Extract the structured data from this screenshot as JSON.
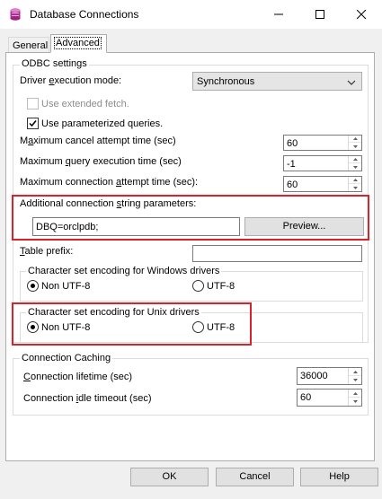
{
  "window": {
    "title": "Database Connections",
    "icon": "database-icon",
    "controls": [
      "minimize-icon",
      "maximize-icon",
      "close-icon"
    ]
  },
  "tabs": [
    {
      "label": "General",
      "active": false
    },
    {
      "label": "Advanced",
      "active": true
    }
  ],
  "odbc": {
    "group_label": "ODBC settings",
    "driver_mode_label_pre": "Driver ",
    "driver_mode_label_u": "e",
    "driver_mode_label_post": "xecution mode:",
    "driver_mode_value": "Synchronous",
    "extended_fetch_label": "Use extended fetch.",
    "extended_fetch_checked": false,
    "parameterized_label": "Use parameterized queries.",
    "parameterized_checked": true,
    "cancel_label_pre": "M",
    "cancel_label_u": "a",
    "cancel_label_post": "ximum cancel attempt time (sec)",
    "cancel_value": "60",
    "query_label_pre": "Maximum ",
    "query_label_u": "q",
    "query_label_post": "uery execution time (sec)",
    "query_value": "-1",
    "conn_attempt_label_pre": "Maximum connection ",
    "conn_attempt_label_u": "a",
    "conn_attempt_label_post": "ttempt time (sec):",
    "conn_attempt_value": "60",
    "additional_label_pre": "Additional connection ",
    "additional_label_u": "s",
    "additional_label_post": "tring parameters:",
    "additional_value": "DBQ=orclpdb;",
    "preview_label": "Preview...",
    "table_prefix_label_pre": "",
    "table_prefix_label_u": "T",
    "table_prefix_label_post": "able prefix:",
    "table_prefix_value": "",
    "windows_encoding_label": "Character set encoding for Windows drivers",
    "unix_encoding_label": "Character set encoding for Unix drivers",
    "non_utf8_label": "Non UTF-8",
    "utf8_label": "UTF-8",
    "windows_selected": "Non UTF-8",
    "unix_selected": "Non UTF-8"
  },
  "caching": {
    "group_label": "Connection Caching",
    "lifetime_label_pre": "",
    "lifetime_label_u": "C",
    "lifetime_label_post": "onnection lifetime (sec)",
    "lifetime_value": "36000",
    "idle_label_pre": "Connection ",
    "idle_label_u": "i",
    "idle_label_post": "dle timeout (sec)",
    "idle_value": "60"
  },
  "buttons": {
    "ok": "OK",
    "cancel": "Cancel",
    "help": "Help"
  },
  "highlight_color": "#d9232a"
}
